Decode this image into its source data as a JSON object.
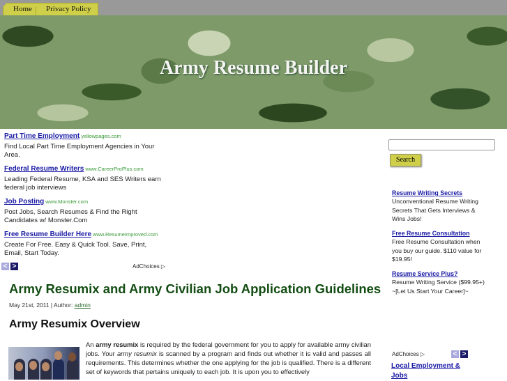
{
  "nav": {
    "tabs": [
      "Home",
      "Privacy Policy"
    ]
  },
  "header": {
    "title": "Army Resume Builder"
  },
  "ads": [
    {
      "title": "Part Time Employment",
      "url": "yellowpages.com",
      "text": "Find Local Part Time Employment Agencies in Your Area."
    },
    {
      "title": "Federal Resume Writers",
      "url": "www.CareerProPlus.com",
      "text": "Leading Federal Resume, KSA and SES Writers earn federal job interviews"
    },
    {
      "title": "Job Posting",
      "url": "www.Monster.com",
      "text": "Post Jobs, Search Resumes & Find the Right Candidates w/ Monster.Com"
    },
    {
      "title": "Free Resume Builder Here",
      "url": "www.ResumeImproved.com",
      "text": "Create For Free. Easy & Quick Tool. Save, Print, Email, Start Today."
    }
  ],
  "adchoices": "AdChoices",
  "arrows": {
    "prev": "<",
    "next": ">"
  },
  "post": {
    "title": "Army Resumix and Army Civilian Job Application Guidelines",
    "date": "May 21st, 2011 | Author: ",
    "author": "admin",
    "heading": "Army Resumix Overview",
    "p1_a": "An ",
    "p1_b": "army resumix",
    "p1_c": " is required by the federal government for you to apply for available army civilian jobs. Your ",
    "p1_d": "army resumix",
    "p1_e": " is scanned by a program and finds out whether it is valid and passes all requirements. This determines whether the one applying for the job is qualified. There is a different set of keywords that pertains uniquely to each job. It is upon you to effectively"
  },
  "sidebar": {
    "search_label": "Search",
    "search_value": "",
    "ads": [
      {
        "title": "Resume Writing Secrets ",
        "text": "Unconventional Resume Writing Secrets That Gets Interviews & Wins Jobs!"
      },
      {
        "title": "Free Resume Consultation ",
        "text": "Free Resume Consultation when you buy our guide. $110 value for $19.95!"
      },
      {
        "title": "Resume Service Plus? ",
        "text": "Resume Writing Service ($99.95+) ~[Let Us Start Your Career]~"
      }
    ],
    "link": "Local Employment & Jobs"
  }
}
